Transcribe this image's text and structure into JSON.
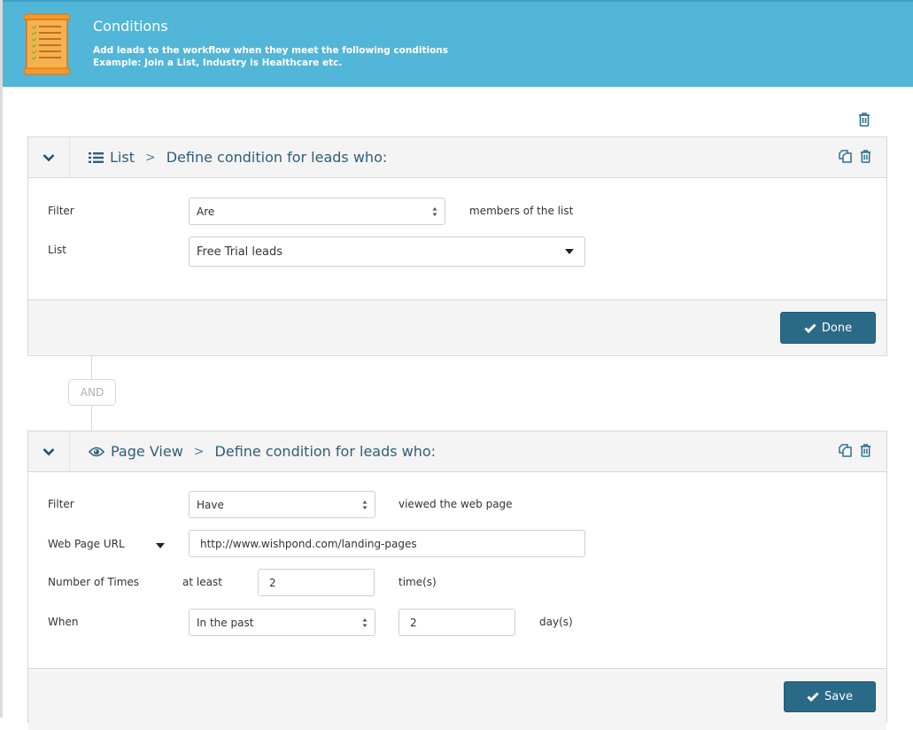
{
  "header": {
    "icon": "checklist-scroll-icon",
    "title": "Conditions",
    "description_line1": "Add leads to the workflow when they meet the following conditions",
    "description_line2": "Example: Join a List, Industry is Healthcare etc."
  },
  "global_actions": {
    "delete_icon": "trash-icon"
  },
  "conditions": [
    {
      "type_icon": "list-icon",
      "type_label": "List",
      "separator": ">",
      "heading": "Define condition for leads who:",
      "actions": [
        "duplicate-icon",
        "trash-icon"
      ],
      "fields": {
        "filter_label": "Filter",
        "filter_value": "Are",
        "filter_suffix": "members of the list",
        "list_label": "List",
        "list_value": "Free Trial leads"
      },
      "footer_button": "Done"
    },
    {
      "type_icon": "eye-icon",
      "type_label": "Page View",
      "separator": ">",
      "heading": "Define condition for leads who:",
      "actions": [
        "duplicate-icon",
        "trash-icon"
      ],
      "fields": {
        "filter_label": "Filter",
        "filter_value": "Have",
        "filter_suffix": "viewed the web page",
        "url_label": "Web Page URL",
        "url_value": "http://www.wishpond.com/landing-pages",
        "times_label": "Number of Times",
        "times_prefix": "at least",
        "times_value": "2",
        "times_suffix": "time(s)",
        "when_label": "When",
        "when_value": "In the past",
        "when_amount": "2",
        "when_suffix": "day(s)"
      },
      "footer_button": "Save"
    }
  ],
  "operator": "AND",
  "colors": {
    "header_bg": "#52b6d8",
    "primary_button": "#2b6a87",
    "heading_text": "#2e5f7a"
  }
}
